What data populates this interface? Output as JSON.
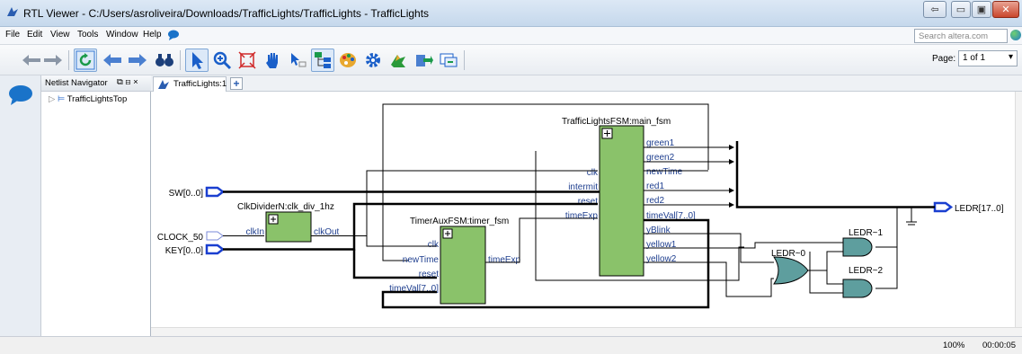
{
  "window": {
    "title": "RTL Viewer - C:/Users/asroliveira/Downloads/TrafficLights/TrafficLights - TrafficLights",
    "min_glyph": "⇦",
    "restore_glyph": "▭",
    "maximize_glyph": "▣",
    "close_glyph": "✕"
  },
  "menu": {
    "items": [
      "File",
      "Edit",
      "View",
      "Tools",
      "Window",
      "Help"
    ],
    "search_placeholder": "Search altera.com"
  },
  "toolbar": {
    "icons": [
      "back-icon",
      "forward-icon",
      "refresh-icon",
      "back-arrow-icon",
      "forward-arrow-icon",
      "binoculars-icon",
      "select-icon",
      "zoom-icon",
      "fit-icon",
      "hand-icon",
      "net-select-icon",
      "hierarchy-icon",
      "palette-icon",
      "gear-icon",
      "bird-icon",
      "export-icon",
      "windows-icon"
    ],
    "page_label": "Page:",
    "page_value": "1 of 1"
  },
  "navigator": {
    "title": "Netlist Navigator",
    "controls": "⧉ ⊟ ×",
    "tree_item": "TrafficLightsTop"
  },
  "tabs": {
    "active": "TrafficLights:1",
    "add": "+"
  },
  "schematic": {
    "blocks": {
      "main_fsm": {
        "name": "TrafficLightsFSM:main_fsm",
        "inputs": [
          "clk",
          "intermit",
          "reset",
          "timeExp"
        ],
        "outputs": [
          "green1",
          "green2",
          "newTime",
          "red1",
          "red2",
          "timeVal[7..0]",
          "yBlink",
          "yellow1",
          "yellow2"
        ]
      },
      "clk_div": {
        "name": "ClkDividerN:clk_div_1hz",
        "inputs": [
          "clkIn"
        ],
        "outputs": [
          "clkOut"
        ]
      },
      "timer_fsm": {
        "name": "TimerAuxFSM:timer_fsm",
        "inputs": [
          "clk",
          "newTime",
          "reset",
          "timeVal[7..0]"
        ],
        "outputs": [
          "timeExp"
        ]
      }
    },
    "ports": {
      "sw": "SW[0..0]",
      "clock": "CLOCK_50",
      "key": "KEY[0..0]",
      "ledr": "LEDR[17..0]"
    },
    "gates": {
      "or0": "LEDR~0",
      "and1": "LEDR~1",
      "and2": "LEDR~2"
    }
  },
  "status": {
    "zoom": "100%",
    "time": "00:00:05"
  }
}
